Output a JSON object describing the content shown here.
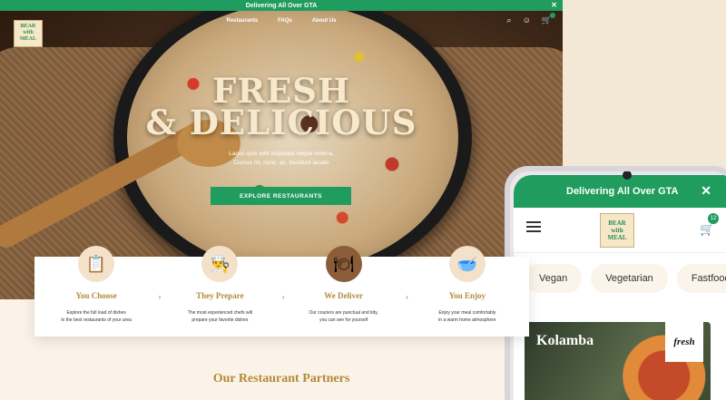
{
  "desktop": {
    "promo_text": "Delivering All Over GTA",
    "close_icon": "close-icon",
    "nav": [
      "Restaurants",
      "FAQs",
      "About Us"
    ],
    "logo_lines": [
      "BEAR",
      "with",
      "MEAL"
    ],
    "hero": {
      "title_line1": "FRESH",
      "title_line2": "& DELICIOUS",
      "subtitle_line1": "Lacus quis velit vulputate neque viverra.",
      "subtitle_line2": "Cursus mi, nunc, ac, tincidunt iaculis",
      "cta": "EXPLORE RESTAURANTS"
    },
    "steps": [
      {
        "title": "You Choose",
        "line1": "Explore the full load of dishes",
        "line2": "in the best restaurants of your area",
        "icon": "menu-card-icon"
      },
      {
        "title": "They Prepare",
        "line1": "The most experienced chefs will",
        "line2": "prepare your favorite dishes",
        "icon": "chef-hat-icon"
      },
      {
        "title": "We Deliver",
        "line1": "Our couriers are punctual and tidy,",
        "line2": "you can see for yourself",
        "icon": "cloche-icon"
      },
      {
        "title": "You Enjoy",
        "line1": "Enjoy your meal comfortably",
        "line2": "in a warm home atmosphere",
        "icon": "bowl-icon"
      }
    ],
    "partners_heading": "Our Restaurant Partners"
  },
  "phone": {
    "promo_text": "Delivering All Over GTA",
    "cart_count": "12",
    "chips": [
      "Vegan",
      "Vegetarian",
      "Fastfood"
    ],
    "card": {
      "name": "Kolamba",
      "brand": "fresh"
    }
  },
  "colors": {
    "accent": "#1f9c5e",
    "gold": "#b18a36",
    "cream": "#f3e7d6"
  }
}
